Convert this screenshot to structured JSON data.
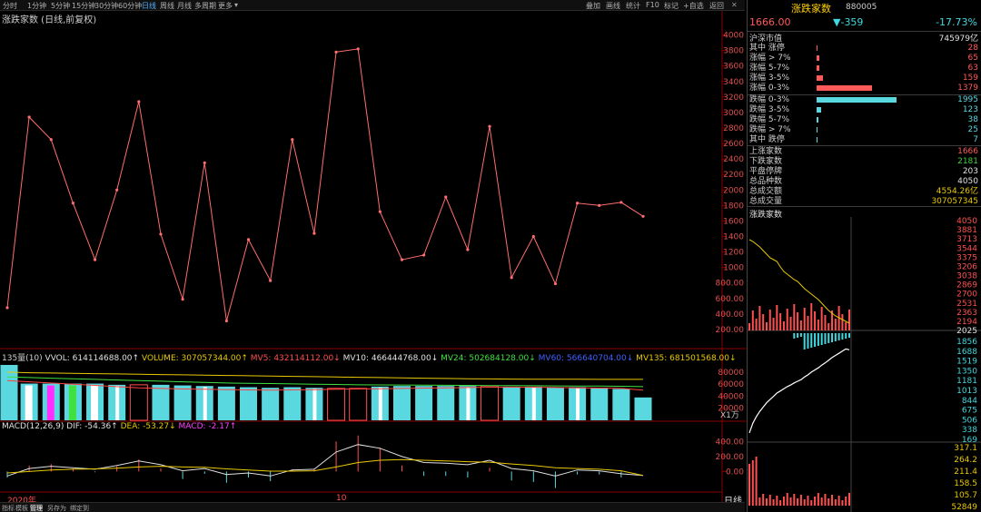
{
  "toolbar": {
    "periods": [
      "分时",
      "1分钟",
      "5分钟",
      "15分钟",
      "30分钟",
      "60分钟",
      "日线",
      "周线",
      "月线",
      "多周期",
      "更多"
    ],
    "active_period": "日线",
    "right_items": [
      "叠加",
      "画线",
      "统计",
      "F10",
      "标记",
      "+自选",
      "返回"
    ]
  },
  "chart_title": "涨跌家数 (日线,前复权)",
  "vol_header": {
    "prefix": "135量(10)",
    "items": [
      {
        "text": "VVOL: 614114688.00↑",
        "color": "#e0e0e0"
      },
      {
        "text": "VOLUME: 307057344.00↑",
        "color": "#e8c800"
      },
      {
        "text": "MV5: 432114112.00↓",
        "color": "#ff5050"
      },
      {
        "text": "MV10: 466444768.00↓",
        "color": "#e0e0e0"
      },
      {
        "text": "MV24: 502684128.00↓",
        "color": "#40e040"
      },
      {
        "text": "MV60: 566640704.00↓",
        "color": "#4060ff"
      },
      {
        "text": "MV135: 681501568.00↓",
        "color": "#e8c800"
      }
    ]
  },
  "macd_header": {
    "items": [
      {
        "text": "MACD(12,26,9) DIF: -54.36↑",
        "color": "#e0e0e0"
      },
      {
        "text": "DEA: -53.27↓",
        "color": "#e8c800"
      },
      {
        "text": "MACD: -2.17↑",
        "color": "#ff40ff"
      }
    ]
  },
  "vol_label_bottom": "X1万",
  "period_label": "日线",
  "x_labels": {
    "start": "2020年",
    "mid": "10"
  },
  "bottom_tabs": [
    "指标",
    "模板",
    "管理",
    "另存为",
    "绑定到"
  ],
  "chart_data": [
    {
      "type": "line",
      "title": "涨跌家数 (日线,前复权)",
      "ylim": [
        0,
        4100
      ],
      "yticks": [
        200,
        400,
        600,
        800,
        1000,
        1200,
        1400,
        1600,
        1800,
        2000,
        2200,
        2400,
        2600,
        2800,
        3000,
        3200,
        3400,
        3600,
        3800,
        4000
      ],
      "ytick_labels": [
        "200.00",
        "400.00",
        "600.00",
        "800.00",
        "1000",
        "1200",
        "1400",
        "1600",
        "1800",
        "2000",
        "2200",
        "2400",
        "2600",
        "2800",
        "3000",
        "3200",
        "3400",
        "3600",
        "3800",
        "4000"
      ],
      "values": [
        480,
        2940,
        2650,
        1830,
        1100,
        2000,
        3140,
        1430,
        590,
        2350,
        310,
        1360,
        830,
        2650,
        1440,
        3780,
        3820,
        1720,
        1100,
        1160,
        1910,
        1230,
        2820,
        870,
        1400,
        790,
        1830,
        1800,
        1840,
        1660
      ]
    },
    {
      "type": "bar",
      "title": "135量(10)",
      "ytick_labels": [
        "20000",
        "40000",
        "60000",
        "80000"
      ],
      "ylim": [
        0,
        95000
      ],
      "values": [
        92000,
        61000,
        61000,
        61000,
        61000,
        59000,
        59000,
        59000,
        58000,
        57000,
        56000,
        55000,
        54000,
        55000,
        54000,
        53000,
        53000,
        56000,
        57000,
        57000,
        57000,
        57000,
        57000,
        56000,
        56000,
        55000,
        55000,
        54000,
        52000,
        38000
      ],
      "mv": [
        {
          "name": "MV5",
          "values": [
            66000,
            64000,
            62000,
            60000,
            58000,
            56000,
            54000,
            53000,
            52000,
            51500,
            51000,
            50500,
            50000,
            50500,
            51000,
            51500,
            52000,
            52500,
            53000,
            53500,
            54000,
            54500,
            55000,
            55000,
            55000,
            54500,
            54000,
            53500,
            53000,
            50000
          ]
        },
        {
          "name": "MV135",
          "values": [
            80000,
            79000,
            78500,
            78000,
            77500,
            77000,
            76500,
            76000,
            75500,
            75000,
            74500,
            74000,
            73500,
            73000,
            72500,
            72000,
            71500,
            71000,
            70500,
            70000,
            69500,
            69000,
            68800,
            68500,
            68300,
            68200,
            68100,
            68000,
            68000,
            68000
          ]
        },
        {
          "name": "MV24",
          "values": [
            72000,
            71000,
            70000,
            69000,
            68000,
            67000,
            66000,
            65000,
            64000,
            63000,
            62000,
            61500,
            61000,
            60500,
            60000,
            59500,
            59000,
            58800,
            58600,
            58400,
            58200,
            58000,
            57800,
            57600,
            57400,
            57200,
            57000,
            56800,
            56600,
            56000
          ]
        }
      ]
    },
    {
      "type": "line",
      "title": "MACD(12,26,9)",
      "ylim": [
        -250,
        550
      ],
      "ytick_labels": [
        "0.00",
        "200.00",
        "400.00"
      ],
      "series": [
        {
          "name": "DIF",
          "values": [
            -60,
            40,
            70,
            50,
            30,
            80,
            140,
            90,
            10,
            40,
            -40,
            -20,
            -60,
            20,
            30,
            260,
            360,
            310,
            200,
            120,
            110,
            90,
            150,
            40,
            10,
            -60,
            20,
            10,
            -30,
            -54
          ]
        },
        {
          "name": "DEA",
          "values": [
            -20,
            0,
            20,
            30,
            35,
            45,
            60,
            70,
            60,
            55,
            35,
            20,
            5,
            5,
            10,
            60,
            120,
            150,
            160,
            150,
            140,
            130,
            125,
            100,
            80,
            50,
            40,
            30,
            10,
            -53
          ]
        }
      ]
    }
  ],
  "right_panel": {
    "name": "涨跌家数",
    "code": "880005",
    "price": "1666.00",
    "change": "-359",
    "pct": "-17.73%",
    "market_label": "沪深市值",
    "market_value": "745979亿",
    "up_rows": [
      {
        "label": "其中 涨停",
        "value": "28",
        "ratio": 0.014
      },
      {
        "label": "涨幅 > 7%",
        "value": "65",
        "ratio": 0.033
      },
      {
        "label": "涨幅 5-7%",
        "value": "63",
        "ratio": 0.032
      },
      {
        "label": "涨幅 3-5%",
        "value": "159",
        "ratio": 0.08
      },
      {
        "label": "涨幅 0-3%",
        "value": "1379",
        "ratio": 0.69
      }
    ],
    "down_rows": [
      {
        "label": "跌幅 0-3%",
        "value": "1995",
        "ratio": 1.0
      },
      {
        "label": "跌幅 3-5%",
        "value": "123",
        "ratio": 0.062
      },
      {
        "label": "跌幅 5-7%",
        "value": "38",
        "ratio": 0.019
      },
      {
        "label": "跌幅 > 7%",
        "value": "25",
        "ratio": 0.013
      },
      {
        "label": "其中 跌停",
        "value": "7",
        "ratio": 0.004
      }
    ],
    "stats": [
      {
        "label": "上涨家数",
        "value": "1666",
        "color": "#ff5a5a"
      },
      {
        "label": "下跌家数",
        "value": "2181",
        "color": "#40d040"
      },
      {
        "label": "平盘停牌",
        "value": "203",
        "color": "#e0e0e0"
      },
      {
        "label": "总品种数",
        "value": "4050",
        "color": "#e0e0e0"
      },
      {
        "label": "总成交额",
        "value": "4554.26亿",
        "color": "#e8c800"
      },
      {
        "label": "总成交量",
        "value": "307057345",
        "color": "#e8c800"
      }
    ],
    "mini_title": "涨跌家数",
    "mini_axis_top": [
      "4050",
      "3881",
      "3713",
      "3544",
      "3375",
      "3206",
      "3038",
      "2869",
      "2700",
      "2531",
      "2363",
      "2194",
      "2025"
    ],
    "mini_axis_mid": [
      "1856",
      "1688",
      "1519",
      "1350",
      "1181",
      "1013",
      "844",
      "675",
      "506",
      "338",
      "169"
    ],
    "mini_axis_bottom": [
      "317.1",
      "264.2",
      "211.4",
      "158.5",
      "105.7",
      "52849"
    ],
    "mini_yellow": [
      1500,
      1480,
      1450,
      1420,
      1380,
      1340,
      1300,
      1280,
      1260,
      1200,
      1150,
      1120,
      1090,
      1060,
      1040,
      1000,
      960,
      930,
      900,
      870,
      840,
      800,
      760,
      720,
      690,
      660,
      640,
      620,
      600,
      580
    ],
    "mini_white": [
      120,
      300,
      420,
      520,
      600,
      680,
      740,
      800,
      860,
      900,
      940,
      980,
      1010,
      1050,
      1080,
      1110,
      1160,
      1200,
      1250,
      1290,
      1330,
      1380,
      1420,
      1470,
      1520,
      1560,
      1600,
      1640,
      1680,
      1666
    ]
  },
  "colors": {
    "up": "#ff5a5a",
    "down": "#5ad8e0",
    "grid": "#8a0000",
    "price_line": "#ff6e6e",
    "yellow": "#e8c800"
  }
}
